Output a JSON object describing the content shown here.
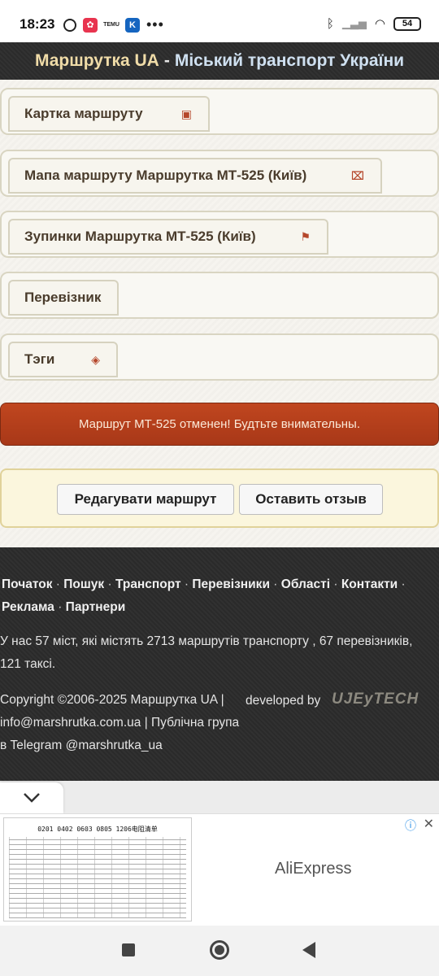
{
  "status_bar": {
    "time": "18:23",
    "battery": "54"
  },
  "header": {
    "brand": "Маршрутка UA",
    "separator": "-",
    "subtitle": "Міський транспорт України"
  },
  "tabs": [
    {
      "label": "Картка маршруту",
      "icon": "bus-icon"
    },
    {
      "label": "Мапа маршруту Маршрутка МТ-525 (Київ)",
      "icon": "map-icon"
    },
    {
      "label": "Зупинки Маршрутка МТ-525 (Київ)",
      "icon": "flag-icon"
    },
    {
      "label": "Перевізник",
      "icon": ""
    },
    {
      "label": "Тэги",
      "icon": "tag-icon"
    }
  ],
  "alert": {
    "text": "Маршрут МТ-525 отменен! Будтьте внимательны."
  },
  "actions": {
    "edit_label": "Редагувати маршрут",
    "review_label": "Оставить отзыв"
  },
  "footer": {
    "nav": [
      "Початок",
      "Пошук",
      "Транспорт",
      "Перевізники",
      "Області",
      "Контакти",
      "Реклама",
      "Партнери"
    ],
    "nav_separator": "·",
    "stats": "У нас 57 міст, які містять 2713 маршрутів транспорту , 67 перевізників, 121 таксі.",
    "copyright": "Copyright ©2006-2025 Маршрутка UA | info@marshrutka.com.ua | Публічна група в Telegram @marshrutka_ua",
    "developed_by": "developed by",
    "developer_logo": "UJEyTECH"
  },
  "ad": {
    "image_title": "0201 0402 0603 0805 1206电阻清单",
    "brand": "AliExpress"
  },
  "colors": {
    "header_bg": "#2b2b2b",
    "brand": "#f0dca8",
    "alert_bg": "#b33f1b",
    "actions_bg": "#fbf6dd"
  }
}
